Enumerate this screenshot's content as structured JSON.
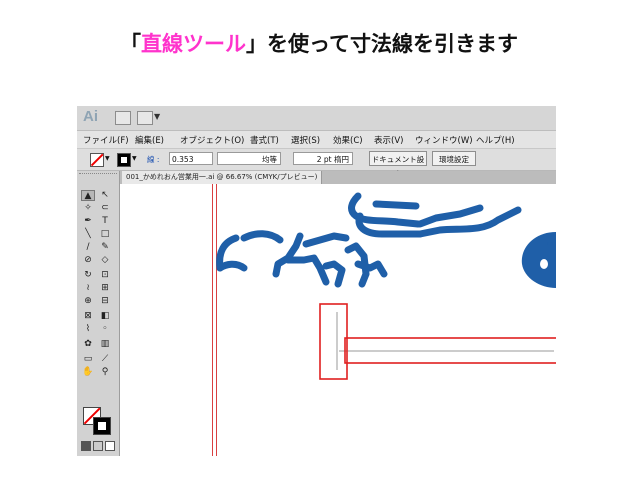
{
  "heading": {
    "open_bracket": "「",
    "tool_name": "直線ツール",
    "rest": "」を使って寸法線を引きます",
    "highlight_color": "#ff33cc"
  },
  "app": {
    "logo": "Ai",
    "menu": [
      "ファイル(F)",
      "編集(E)",
      "オブジェクト(O)",
      "書式(T)",
      "選択(S)",
      "効果(C)",
      "表示(V)",
      "ウィンドウ(W)",
      "ヘルプ(H)"
    ],
    "control": {
      "stroke_label": "線 :",
      "stroke_value": "0.353",
      "profile": "均等",
      "brush": "2 pt 楕円",
      "doc_setup": "ドキュメント設定",
      "prefs": "環境設定"
    },
    "doc_tab": "001_かめれおん営業用一.ai @ 66.67% (CMYK/プレビュー)"
  },
  "colors": {
    "drawing_blue": "#1f5fa8",
    "highlight_red": "#e02020"
  }
}
